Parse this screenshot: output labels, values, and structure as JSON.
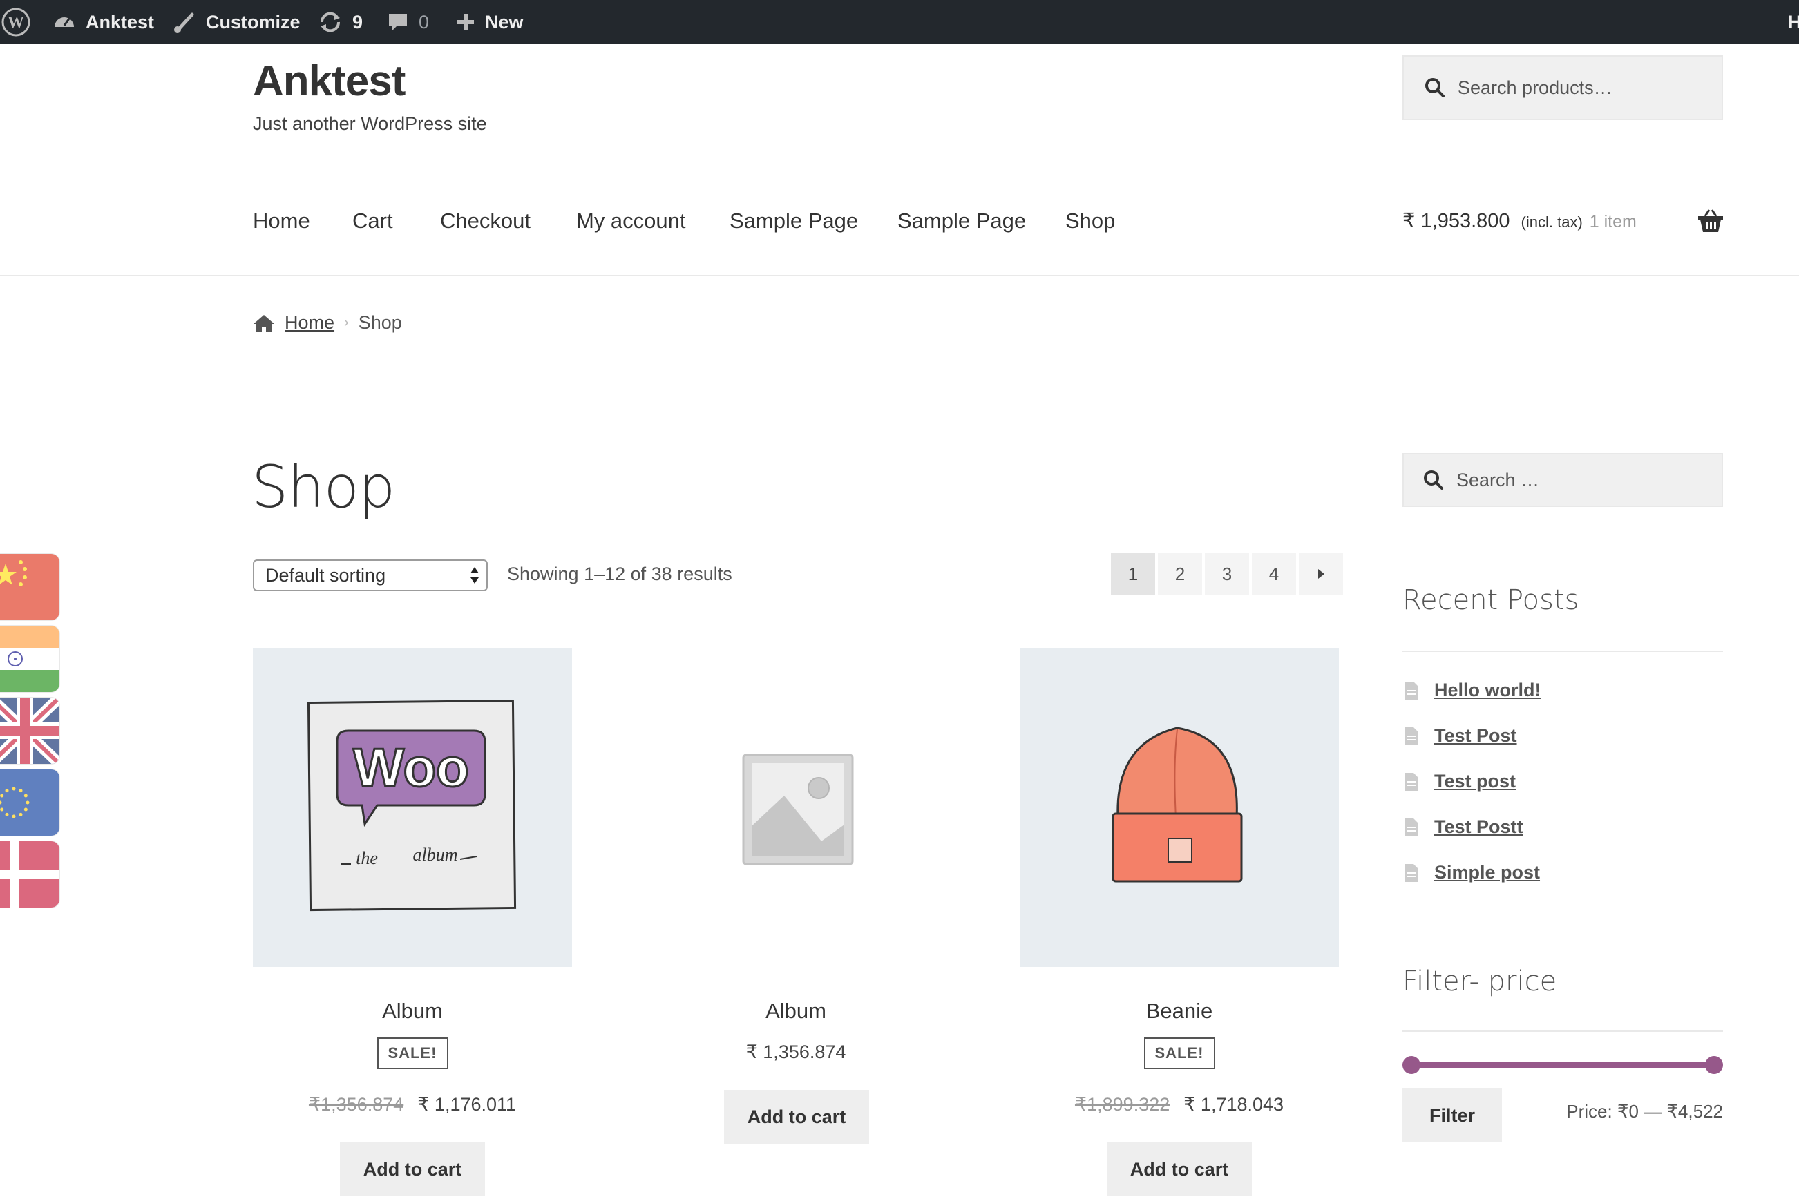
{
  "admin_bar": {
    "site_name": "Anktest",
    "customize": "Customize",
    "updates_count": "9",
    "comments_count": "0",
    "new_label": "New",
    "right_edge_text": "H"
  },
  "header": {
    "site_title": "Anktest",
    "tagline": "Just another WordPress site",
    "search_placeholder": "Search products…"
  },
  "nav": {
    "items": [
      "Home",
      "Cart",
      "Checkout",
      "My account",
      "Sample Page",
      "Sample Page",
      "Shop"
    ]
  },
  "cart": {
    "amount": "₹ 1,953.800",
    "tax_note": "(incl. tax)",
    "count": "1 item"
  },
  "breadcrumb": {
    "home": "Home",
    "current": "Shop"
  },
  "main": {
    "title": "Shop",
    "sorting": "Default sorting",
    "results": "Showing 1–12 of 38 results",
    "pages": [
      "1",
      "2",
      "3",
      "4"
    ],
    "current_page": "1"
  },
  "products": [
    {
      "name": "Album",
      "sale_badge": "SALE!",
      "old_price": "₹1,356.874",
      "price": "₹ 1,176.011",
      "button": "Add to cart",
      "image": "woo-album"
    },
    {
      "name": "Album",
      "price": "₹ 1,356.874",
      "button": "Add to cart",
      "image": "placeholder"
    },
    {
      "name": "Beanie",
      "sale_badge": "SALE!",
      "old_price": "₹1,899.322",
      "price": "₹ 1,718.043",
      "button": "Add to cart",
      "image": "beanie"
    }
  ],
  "woo_album_art": {
    "logo": "Woo",
    "caption_left": "the",
    "caption_right": "album"
  },
  "sidebar": {
    "search_placeholder": "Search …",
    "recent_posts_title": "Recent Posts",
    "recent_posts": [
      "Hello world!",
      "Test Post",
      "Test post",
      "Test Postt",
      "Simple post"
    ],
    "filter_title": "Filter- price",
    "filter_button": "Filter",
    "price_range": "Price: ₹0 — ₹4,522",
    "slider_min_fraction": 0.0,
    "slider_max_fraction": 1.0
  },
  "flags": [
    "china",
    "india",
    "uk",
    "eu",
    "denmark"
  ],
  "colors": {
    "admin_bar": "#23282d",
    "slider": "#96588a",
    "product_bg": "#e8edf1"
  }
}
